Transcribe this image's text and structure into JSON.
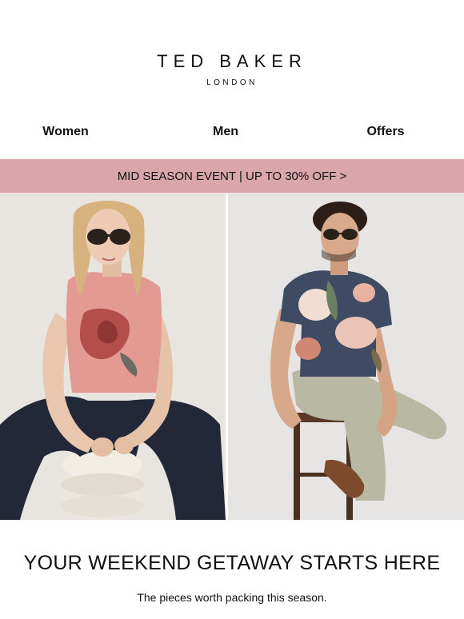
{
  "brand": {
    "name": "TED BAKER",
    "sub": "LONDON"
  },
  "nav": [
    {
      "label": "Women"
    },
    {
      "label": "Men"
    },
    {
      "label": "Offers"
    }
  ],
  "banner": {
    "text": "MID SEASON EVENT | UP TO 30% OFF >"
  },
  "hero": {
    "left_image": "woman-in-rose-print-top",
    "right_image": "man-in-floral-tshirt"
  },
  "headline": "YOUR WEEKEND GETAWAY STARTS HERE",
  "subline": "The pieces worth packing this season."
}
